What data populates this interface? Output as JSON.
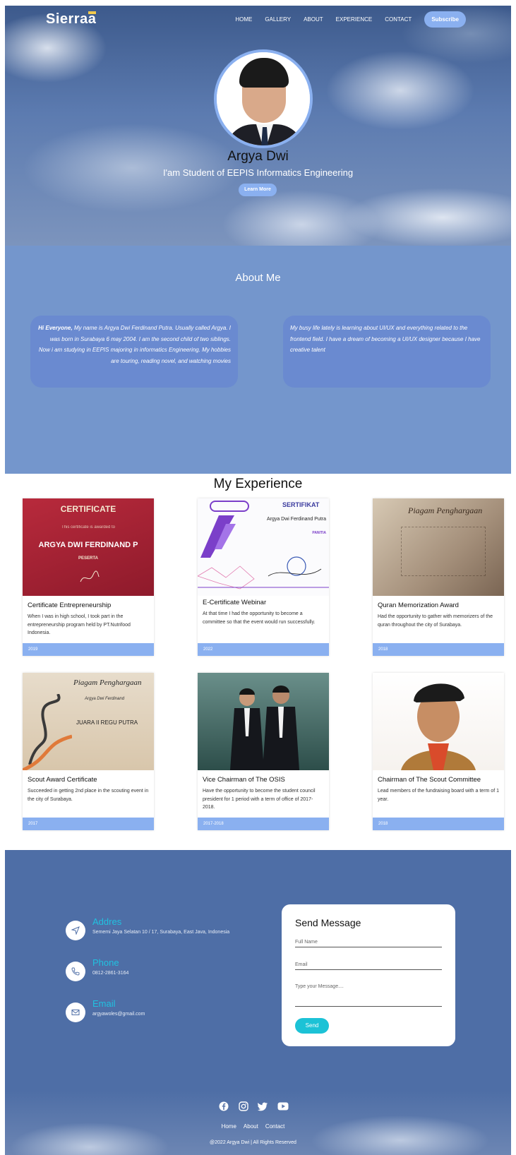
{
  "nav": {
    "logo": "Sierra",
    "logo_accent": "a",
    "links": [
      "HOME",
      "GALLERY",
      "ABOUT",
      "EXPERIENCE",
      "CONTACT"
    ],
    "subscribe": "Subscribe"
  },
  "hero": {
    "name": "Argya Dwi",
    "subtitle": "I'am Student of EEPIS Informatics Engineering",
    "cta": "Learn More"
  },
  "about": {
    "title": "About Me",
    "left_lead": "Hi Everyone,",
    "left_text": " My name is Argya Dwi Ferdinand Putra. Usually called Argya. I was born in Surabaya 6 may 2004. I am the second child of two siblings. Now i am studying in EEPIS majoring in informatics Engineering. My hobbies are touring, reading novel, and watching movies",
    "right_text": "My busy life lately is learning about UI/UX and everything related to the frontend field. I have a dream of becoming a UI/UX designer because I have creative talent"
  },
  "experience": {
    "title": "My Experience",
    "cards": [
      {
        "title": "Certificate Entrepreneurship",
        "desc": "When I was in high school, I took part in the entrepreneurship program held by PT.Nutrifood Indonesia.",
        "year": "2019",
        "img_heading": "CERTIFICATE",
        "img_sub": "This certificate is awarded to",
        "img_name": "ARGYA DWI FERDINAND P",
        "img_role": "PESERTA"
      },
      {
        "title": "E-Certificate Webinar",
        "desc": "At that time I had the opportunity to become a committee so that the event would run successfully.",
        "year": "2022",
        "img_heading": "SERTIFIKAT",
        "img_name": "Argya Dwi Ferdinand Putra",
        "img_role": "PANITIA"
      },
      {
        "title": "Quran Memorization Award",
        "desc": "Had the opportunity to gather with memorizers of the quran throughout the city of Surabaya.",
        "year": "2018",
        "img_heading": "Piagam Penghargaan"
      },
      {
        "title": "Scout Award Certificate",
        "desc": "Succeeded in getting 2nd place in the scouting event in the city of Surabaya.",
        "year": "2017",
        "img_heading": "Piagam Penghargaan",
        "img_name": "Argya Dwi Ferdinand",
        "img_role": "JUARA II REGU PUTRA"
      },
      {
        "title": "Vice Chairman of The OSIS",
        "desc": "Have the opportunity to become the student council president for 1 period with a term of office of 2017-2018.",
        "year": "2017-2018"
      },
      {
        "title": "Chairman of The Scout Committee",
        "desc": "Lead members of the fundraising board with a term of 1 year.",
        "year": "2018"
      }
    ]
  },
  "contact": {
    "address_label": "Addres",
    "address_value": "Sememi Jaya Selatan 10 / 17, Surabaya, East Java, Indonesia",
    "phone_label": "Phone",
    "phone_value": "0812-2861-3164",
    "email_label": "Email",
    "email_value": "argyawoles@gmail.com",
    "form_title": "Send Message",
    "name_placeholder": "Full Name",
    "email_placeholder": "Email",
    "message_placeholder": "Type your Message....",
    "send": "Send"
  },
  "footer": {
    "social": [
      "facebook-icon",
      "instagram-icon",
      "twitter-icon",
      "youtube-icon"
    ],
    "links": [
      "Home",
      "About",
      "Contact"
    ],
    "copyright": "@2022 Argya Dwi | All Rights Reserved"
  },
  "colors": {
    "accent": "#8ab0f0",
    "about_bg": "#7496cc",
    "contact_bg": "#4e6ea6",
    "cyan": "#21c1e0"
  }
}
